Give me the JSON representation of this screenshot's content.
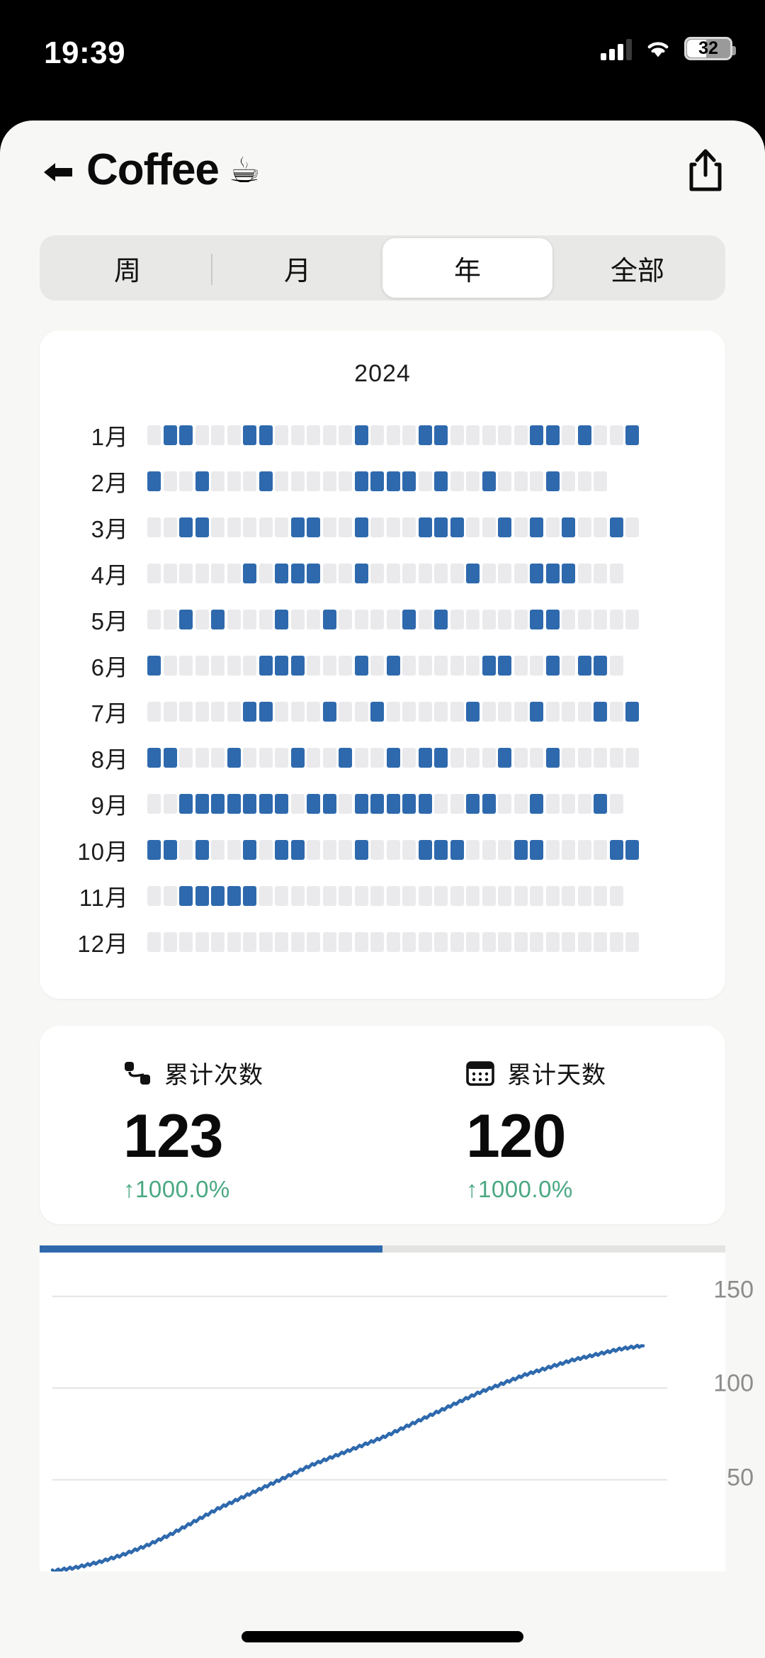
{
  "status_bar": {
    "time": "19:39",
    "battery_percent": "32",
    "signal_icon": "cellular-signal-icon",
    "wifi_icon": "wifi-icon",
    "battery_icon": "battery-icon"
  },
  "header": {
    "back_icon": "back-arrow-icon",
    "title": "Coffee",
    "emoji": "☕",
    "share_icon": "share-icon"
  },
  "segmented": {
    "options": [
      {
        "label": "周",
        "selected": false
      },
      {
        "label": "月",
        "selected": false
      },
      {
        "label": "年",
        "selected": true
      },
      {
        "label": "全部",
        "selected": false
      }
    ]
  },
  "heatmap": {
    "year": "2024",
    "accent_color": "#2e69ad",
    "empty_color": "#eaeaec",
    "months": [
      {
        "label": "1月",
        "days": 31,
        "active": [
          2,
          3,
          7,
          8,
          14,
          18,
          19,
          25,
          26,
          28,
          31
        ]
      },
      {
        "label": "2月",
        "days": 29,
        "active": [
          1,
          4,
          8,
          14,
          15,
          16,
          17,
          19,
          22,
          26
        ]
      },
      {
        "label": "3月",
        "days": 31,
        "active": [
          3,
          4,
          10,
          11,
          14,
          18,
          19,
          20,
          23,
          25,
          27,
          30
        ]
      },
      {
        "label": "4月",
        "days": 30,
        "active": [
          7,
          9,
          10,
          11,
          14,
          21,
          25,
          26,
          27
        ]
      },
      {
        "label": "5月",
        "days": 31,
        "active": [
          3,
          5,
          9,
          12,
          17,
          19,
          25,
          26
        ]
      },
      {
        "label": "6月",
        "days": 30,
        "active": [
          1,
          8,
          9,
          10,
          14,
          16,
          22,
          23,
          26,
          28,
          29
        ]
      },
      {
        "label": "7月",
        "days": 31,
        "active": [
          7,
          8,
          12,
          15,
          21,
          25,
          29,
          31
        ]
      },
      {
        "label": "8月",
        "days": 31,
        "active": [
          1,
          2,
          6,
          10,
          13,
          16,
          18,
          19,
          23,
          26
        ]
      },
      {
        "label": "9月",
        "days": 30,
        "active": [
          3,
          4,
          5,
          6,
          7,
          8,
          9,
          11,
          12,
          14,
          15,
          16,
          17,
          18,
          21,
          22,
          25,
          29
        ]
      },
      {
        "label": "10月",
        "days": 31,
        "active": [
          1,
          2,
          4,
          7,
          9,
          10,
          14,
          18,
          19,
          20,
          24,
          25,
          30,
          31
        ]
      },
      {
        "label": "11月",
        "days": 30,
        "active": [
          3,
          4,
          5,
          6,
          7
        ]
      },
      {
        "label": "12月",
        "days": 31,
        "active": []
      }
    ]
  },
  "stats": [
    {
      "icon": "trend-line-icon",
      "label": "累计次数",
      "value": "123",
      "delta": "↑1000.0%",
      "delta_color": "#4aa882"
    },
    {
      "icon": "calendar-icon",
      "label": "累计天数",
      "value": "120",
      "delta": "↑1000.0%",
      "delta_color": "#4aa882"
    }
  ],
  "progress": {
    "percent": 50,
    "color": "#2e69ad"
  },
  "chart_data": {
    "type": "line",
    "title": "",
    "xlabel": "",
    "ylabel": "",
    "ylim": [
      0,
      170
    ],
    "yticks": [
      50,
      100,
      150
    ],
    "ytick_labels": [
      "50",
      "100",
      "150"
    ],
    "grid": true,
    "legend": "none",
    "line_color": "#2e69ad",
    "series": [
      {
        "name": "累计次数",
        "x": [
          0,
          4,
          8,
          12,
          16,
          20,
          24,
          28,
          32,
          36,
          40,
          44,
          48,
          52,
          56,
          60,
          64,
          68,
          72,
          76,
          80,
          84,
          88,
          92,
          96,
          100
        ],
        "values": [
          0,
          2,
          5,
          9,
          14,
          20,
          27,
          34,
          40,
          46,
          52,
          58,
          63,
          68,
          73,
          79,
          85,
          91,
          97,
          102,
          107,
          111,
          115,
          118,
          121,
          123
        ]
      }
    ]
  },
  "home_indicator": "home-indicator"
}
